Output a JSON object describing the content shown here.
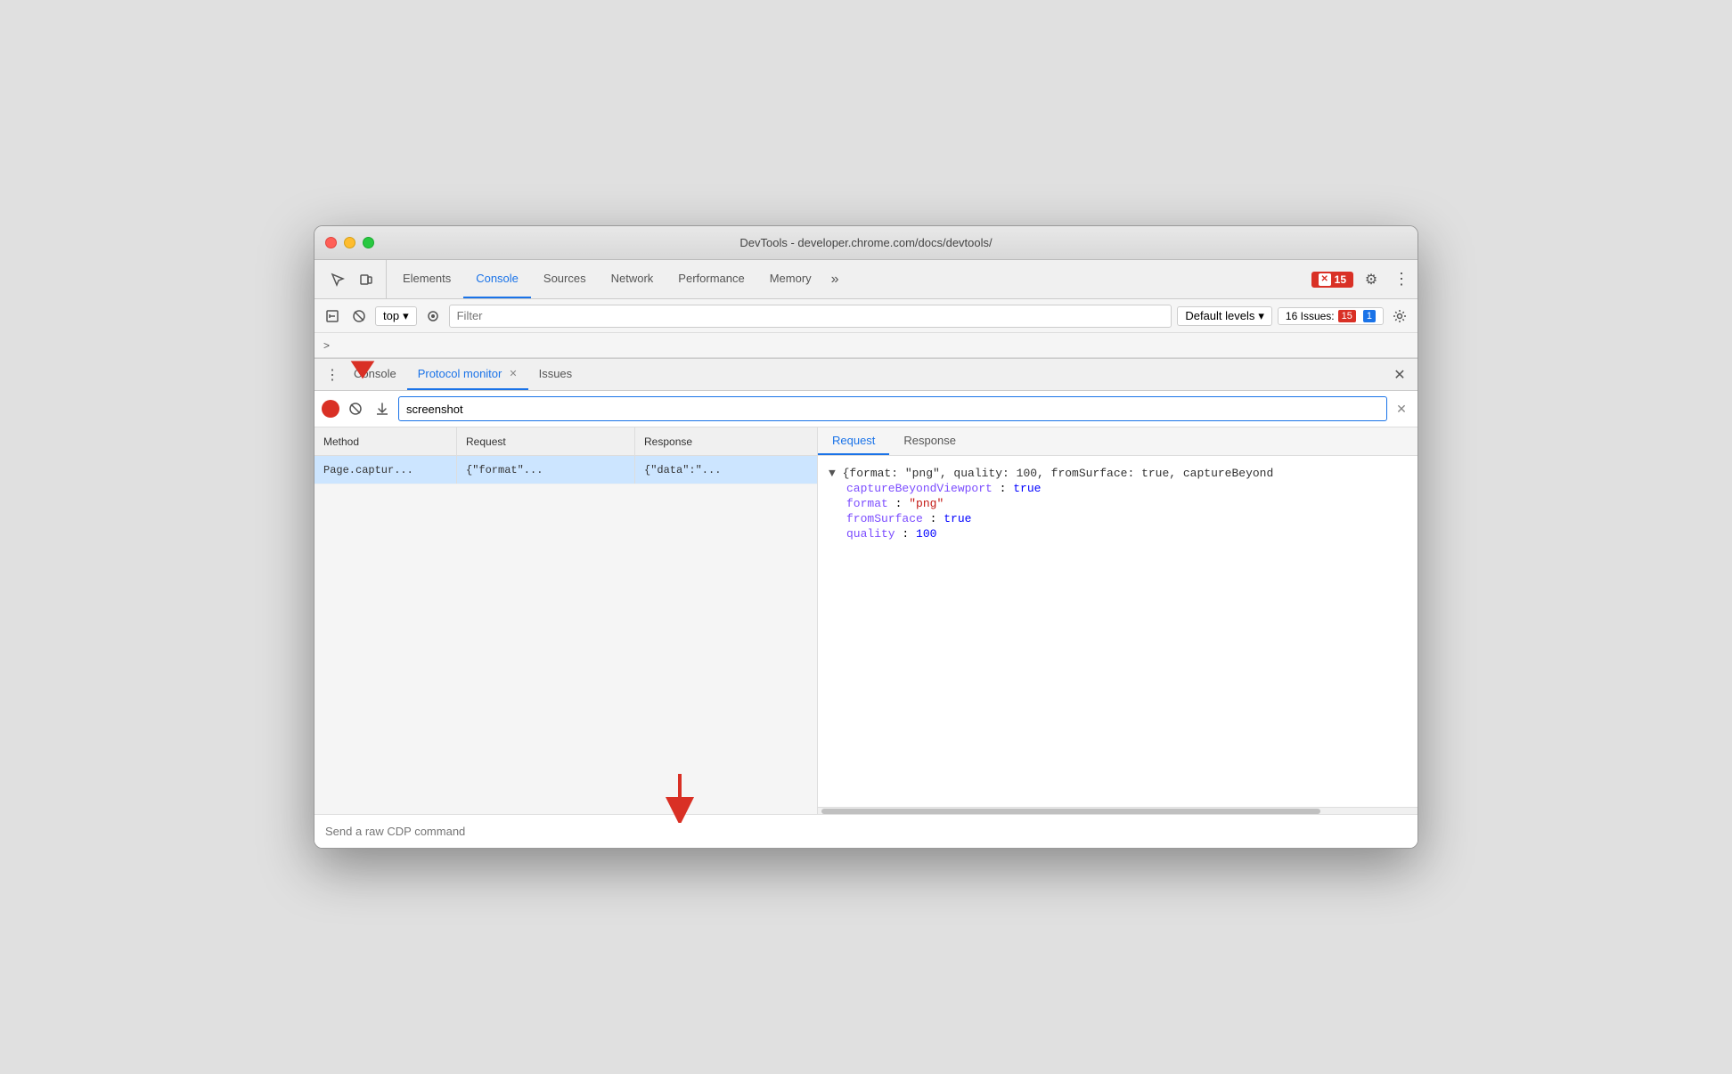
{
  "window": {
    "title": "DevTools - developer.chrome.com/docs/devtools/",
    "traffic_lights": [
      "red",
      "yellow",
      "green"
    ]
  },
  "top_tabs": {
    "items": [
      {
        "label": "Elements",
        "active": false
      },
      {
        "label": "Console",
        "active": true
      },
      {
        "label": "Sources",
        "active": false
      },
      {
        "label": "Network",
        "active": false
      },
      {
        "label": "Performance",
        "active": false
      },
      {
        "label": "Memory",
        "active": false
      }
    ],
    "more_label": "»",
    "error_count": "15",
    "settings_title": "Settings",
    "more_title": "More options"
  },
  "console_toolbar": {
    "execute_label": "▷",
    "clear_label": "🚫",
    "context_label": "top",
    "dropdown_arrow": "▾",
    "eye_label": "👁",
    "filter_placeholder": "Filter",
    "levels_label": "Default levels",
    "levels_arrow": "▾",
    "issues_prefix": "16 Issues:",
    "error_count": "15",
    "info_count": "1",
    "gear_label": "⚙"
  },
  "breadcrumb": {
    "symbol": ">"
  },
  "panel": {
    "dots_label": "⋮",
    "tabs": [
      {
        "label": "Console",
        "active": false,
        "closable": false
      },
      {
        "label": "Protocol monitor",
        "active": true,
        "closable": true
      },
      {
        "label": "Issues",
        "active": false,
        "closable": false
      }
    ],
    "close_label": "✕"
  },
  "search_bar": {
    "search_value": "screenshot",
    "clear_label": "✕",
    "no_entry_label": "🚫",
    "download_label": "⬇"
  },
  "table": {
    "headers": [
      "Method",
      "Request",
      "Response"
    ],
    "rows": [
      {
        "method": "Page.captur...",
        "request": "{\"format\"...",
        "response": "{\"data\":\"..."
      }
    ]
  },
  "right_panel": {
    "tabs": [
      "Request",
      "Response"
    ],
    "active_tab": "Request",
    "summary": "{format: \"png\", quality: 100, fromSurface: true, captureBeyond",
    "fields": [
      {
        "key": "captureBeyondViewport",
        "value": "true",
        "type": "bool"
      },
      {
        "key": "format",
        "value": "\"png\"",
        "type": "str"
      },
      {
        "key": "fromSurface",
        "value": "true",
        "type": "bool"
      },
      {
        "key": "quality",
        "value": "100",
        "type": "num"
      }
    ]
  },
  "bottom_input": {
    "placeholder": "Send a raw CDP command"
  },
  "colors": {
    "accent_blue": "#1a73e8",
    "error_red": "#d93025",
    "json_purple": "#7c4dff",
    "json_red": "#c41a16",
    "json_blue": "#0000ff",
    "selected_row": "#cce5ff"
  }
}
